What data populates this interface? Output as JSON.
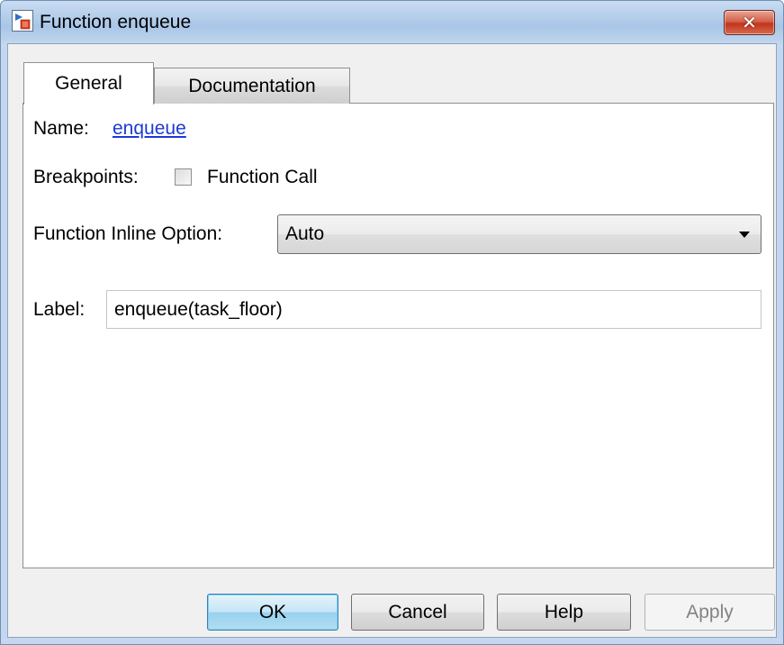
{
  "window": {
    "title": "Function enqueue",
    "close_label": "✕"
  },
  "tabs": [
    {
      "label": "General",
      "selected": true
    },
    {
      "label": "Documentation",
      "selected": false
    }
  ],
  "general": {
    "name_label": "Name:",
    "name_value": "enqueue",
    "breakpoints_label": "Breakpoints:",
    "breakpoint_option": "Function Call",
    "breakpoint_checked": false,
    "inline_label": "Function Inline Option:",
    "inline_value": "Auto",
    "label_label": "Label:",
    "label_value": "enqueue(task_floor)"
  },
  "buttons": {
    "ok": "OK",
    "cancel": "Cancel",
    "help": "Help",
    "apply": "Apply"
  }
}
